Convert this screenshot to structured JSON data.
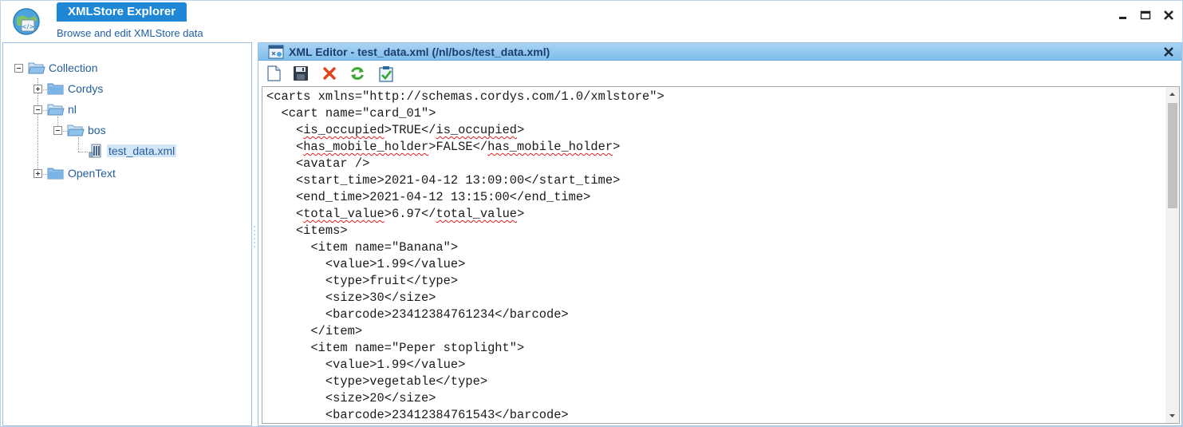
{
  "header": {
    "title": "XMLStore Explorer",
    "subtitle": "Browse and edit XMLStore data",
    "window_controls": [
      "minimize-icon",
      "maximize-icon",
      "close-icon"
    ]
  },
  "tree": {
    "root": "Collection",
    "item_cordys": "Cordys",
    "item_nl": "nl",
    "item_bos": "bos",
    "item_file": "test_data.xml",
    "item_opentext": "OpenText"
  },
  "editor": {
    "title": "XML Editor - test_data.xml (/nl/bos/test_data.xml)",
    "toolbar": [
      "new-document-icon",
      "save-icon",
      "delete-icon",
      "refresh-icon",
      "validate-icon"
    ]
  },
  "code_lines": [
    "<carts xmlns=\"http://schemas.cordys.com/1.0/xmlstore\">",
    "  <cart name=\"card_01\">",
    "    <is_occupied>TRUE</is_occupied>",
    "    <has_mobile_holder>FALSE</has_mobile_holder>",
    "    <avatar />",
    "    <start_time>2021-04-12 13:09:00</start_time>",
    "    <end_time>2021-04-12 13:15:00</end_time>",
    "    <total_value>6.97</total_value>",
    "    <items>",
    "      <item name=\"Banana\">",
    "        <value>1.99</value>",
    "        <type>fruit</type>",
    "        <size>30</size>",
    "        <barcode>23412384761234</barcode>",
    "      </item>",
    "      <item name=\"Peper stoplight\">",
    "        <value>1.99</value>",
    "        <type>vegetable</type>",
    "        <size>20</size>",
    "        <barcode>23412384761543</barcode>"
  ],
  "code_line_3": {
    "open_lt": "    <",
    "open_name": "is_occupied",
    "mid": ">TRUE</",
    "close_name": "is_occupied",
    "end": ">"
  },
  "code_line_4": {
    "open_lt": "    <",
    "open_name": "has_mobile_holder",
    "mid": ">FALSE</",
    "close_name": "has_mobile_holder",
    "end": ">"
  },
  "code_line_8": {
    "open_lt": "    <",
    "open_name": "total_value",
    "mid": ">6.97</",
    "close_name": "total_value",
    "end": ">"
  },
  "colors": {
    "accent": "#1e88d6",
    "panel_border": "#9bc0e2",
    "title_bar": "#7fbdeb",
    "tree_text": "#245e9a",
    "spellcheck": "#e02020"
  }
}
